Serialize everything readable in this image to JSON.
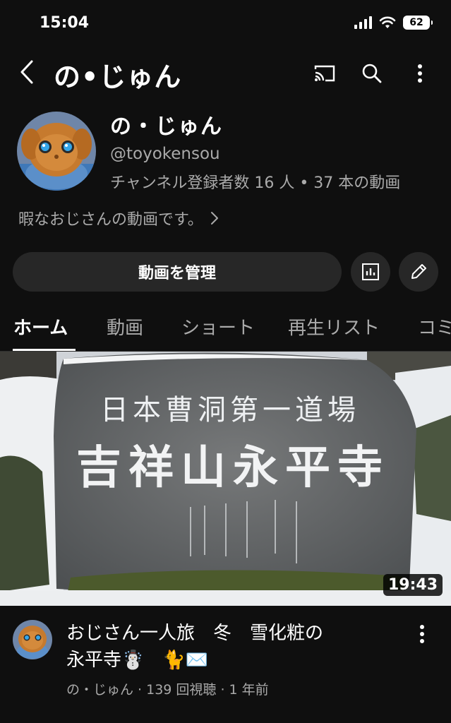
{
  "status_bar": {
    "time": "15:04",
    "battery": "62"
  },
  "app_bar": {
    "title": "の•じゅん"
  },
  "channel": {
    "name": "の・じゅん",
    "handle": "@toyokensou",
    "stats": "チャンネル登録者数 16 人 • 37 本の動画",
    "description": "暇なおじさんの動画です。"
  },
  "actions": {
    "manage_label": "動画を管理"
  },
  "tabs": [
    {
      "label": "ホーム",
      "active": true
    },
    {
      "label": "動画",
      "active": false
    },
    {
      "label": "ショート",
      "active": false
    },
    {
      "label": "再生リスト",
      "active": false
    },
    {
      "label": "コミ",
      "active": false
    }
  ],
  "video": {
    "duration": "19:43",
    "title_line1": "おじさん一人旅　冬　雪化粧の",
    "title_line2": "永平寺☃️　🐈✉️",
    "meta": "の・じゅん · 139 回視聴 · 1 年前",
    "stone_inscription_top": "日本曹洞第一道場",
    "stone_inscription_main": "吉祥山永平寺"
  },
  "icons": [
    "back-icon",
    "cast-icon",
    "search-icon",
    "more-vert-icon",
    "analytics-icon",
    "edit-icon",
    "chevron-right-icon"
  ]
}
